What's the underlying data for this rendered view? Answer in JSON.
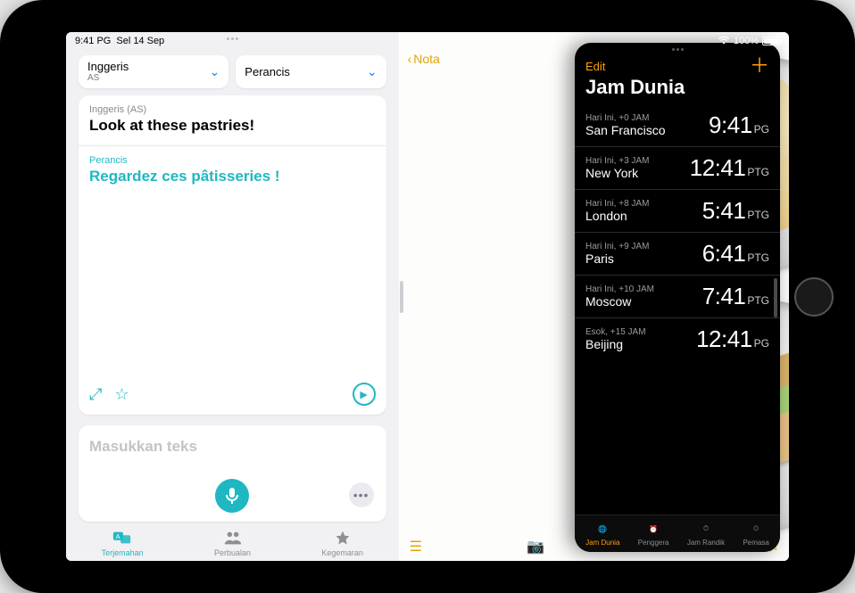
{
  "status": {
    "time": "9:41 PG",
    "date": "Sel 14 Sep",
    "battery": "100%"
  },
  "translate": {
    "lang_from": {
      "name": "Inggeris",
      "sub": "AS"
    },
    "lang_to": {
      "name": "Perancis",
      "sub": ""
    },
    "source_label": "Inggeris (AS)",
    "source_text": "Look at these pastries!",
    "target_label": "Perancis",
    "target_text": "Regardez ces pâtisseries !",
    "input_placeholder": "Masukkan teks",
    "tabs": {
      "translate": "Terjemahan",
      "conversation": "Perbualan",
      "favorites": "Kegemaran"
    }
  },
  "notes": {
    "back": "Nota"
  },
  "clock": {
    "edit": "Edit",
    "title": "Jam Dunia",
    "rows": [
      {
        "offset": "Hari Ini, +0 JAM",
        "city": "San Francisco",
        "time": "9:41",
        "ampm": "PG"
      },
      {
        "offset": "Hari Ini, +3 JAM",
        "city": "New York",
        "time": "12:41",
        "ampm": "PTG"
      },
      {
        "offset": "Hari Ini, +8 JAM",
        "city": "London",
        "time": "5:41",
        "ampm": "PTG"
      },
      {
        "offset": "Hari Ini, +9 JAM",
        "city": "Paris",
        "time": "6:41",
        "ampm": "PTG"
      },
      {
        "offset": "Hari Ini, +10 JAM",
        "city": "Moscow",
        "time": "7:41",
        "ampm": "PTG"
      },
      {
        "offset": "Esok, +15 JAM",
        "city": "Beijing",
        "time": "12:41",
        "ampm": "PG"
      }
    ],
    "tabs": {
      "world": "Jam Dunia",
      "alarm": "Penggera",
      "stopwatch": "Jam Randik",
      "timer": "Pemasa"
    }
  }
}
